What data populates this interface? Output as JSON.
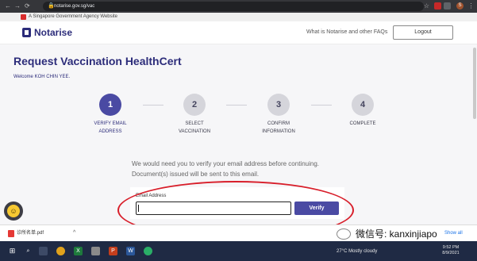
{
  "browser": {
    "url": "notarise.gov.sg/vac",
    "nav_back": "←",
    "nav_forward": "→",
    "nav_reload": "⟳",
    "lock": "🔒"
  },
  "gov_banner": {
    "text": "A Singapore Government Agency Website"
  },
  "header": {
    "brand": "Notarise",
    "faq_link": "What is Notarise and other FAQs",
    "logout_label": "Logout"
  },
  "page": {
    "title": "Request Vaccination HealthCert",
    "welcome": "Welcome KOH CHIN YEE."
  },
  "stepper": {
    "steps": [
      {
        "number": "1",
        "line1": "VERIFY EMAIL",
        "line2": "ADDRESS"
      },
      {
        "number": "2",
        "line1": "SELECT",
        "line2": "VACCINATION"
      },
      {
        "number": "3",
        "line1": "CONFIRM",
        "line2": "INFORMATION"
      },
      {
        "number": "4",
        "line1": "COMPLETE",
        "line2": ""
      }
    ],
    "active_step": 1
  },
  "verify_form": {
    "message_line1": "We would need you to verify your email address before continuing.",
    "message_line2": "Document(s) issued will be sent to this email.",
    "email_label": "Email Address",
    "email_value": "",
    "verify_label": "Verify"
  },
  "downloads": {
    "file_name": "诊所名单.pdf",
    "chevron": "^",
    "show_all": "Show all"
  },
  "watermark": {
    "text": "微信号: kanxinjiapo"
  },
  "taskbar": {
    "weather": "27°C  Mostly cloudy",
    "time": "9:52 PM",
    "date": "8/9/2021"
  },
  "colors": {
    "brand": "#2c2c7a",
    "primary_button": "#4a4aa3",
    "annotation": "#d81e2a"
  }
}
